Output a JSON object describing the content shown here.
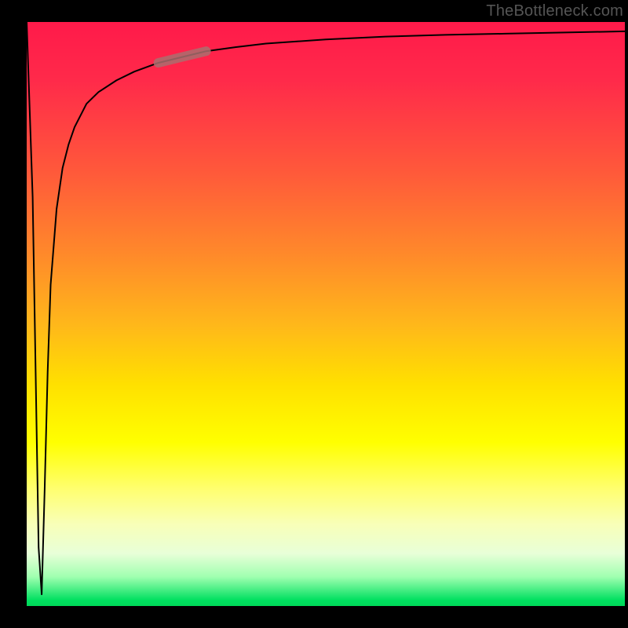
{
  "watermark": "TheBottleneck.com",
  "chart_data": {
    "type": "line",
    "title": "",
    "xlabel": "",
    "ylabel": "",
    "xlim": [
      0,
      100
    ],
    "ylim": [
      0,
      100
    ],
    "x": [
      0,
      1,
      1.5,
      2,
      2.5,
      3,
      3.5,
      4,
      5,
      6,
      7,
      8,
      10,
      12,
      15,
      18,
      22,
      26,
      30,
      35,
      40,
      50,
      60,
      70,
      80,
      90,
      100
    ],
    "values": [
      100,
      70,
      40,
      10,
      2,
      20,
      40,
      55,
      68,
      75,
      79,
      82,
      86,
      88,
      90,
      91.5,
      93,
      94,
      95,
      95.7,
      96.3,
      97,
      97.5,
      97.8,
      98,
      98.2,
      98.4
    ],
    "highlight_segment": {
      "x_start": 22,
      "x_end": 30
    }
  }
}
